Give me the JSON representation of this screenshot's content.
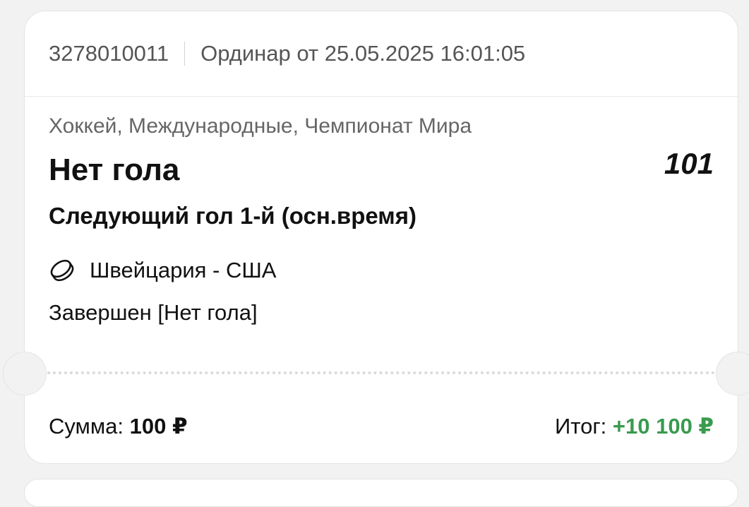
{
  "bet": {
    "id": "3278010011",
    "type_date": "Ординар от 25.05.2025 16:01:05",
    "category": "Хоккей, Международные, Чемпионат Мира",
    "outcome": "Нет гола",
    "odds": "101",
    "market": "Следующий гол 1-й (осн.время)",
    "match": "Швейцария - США",
    "match_icon": "hockey-puck-icon",
    "status": "Завершен [Нет гола]"
  },
  "footer": {
    "stake_label": "Сумма:",
    "stake_value": "100 ₽",
    "result_label": "Итог:",
    "result_value": "+10 100 ₽"
  },
  "colors": {
    "background": "#f2f2f2",
    "card": "#ffffff",
    "win_green": "#3a9a4e",
    "muted_text": "#555555"
  }
}
